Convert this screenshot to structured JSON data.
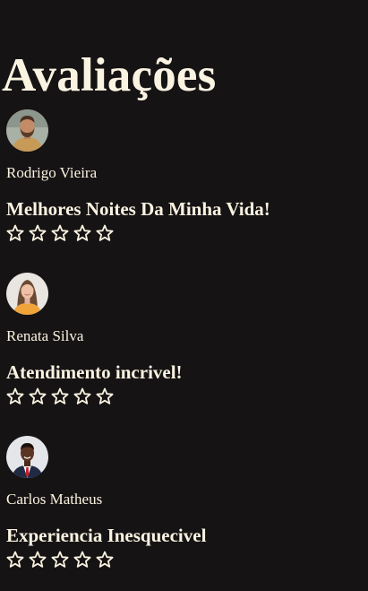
{
  "page": {
    "title": "Avaliações"
  },
  "reviews": [
    {
      "name": "Rodrigo Vieira",
      "title": "Melhores Noites Da Minha Vida!",
      "rating": 5,
      "avatar_icon": "man-beard-avatar"
    },
    {
      "name": "Renata Silva",
      "title": "Atendimento incrivel!",
      "rating": 5,
      "avatar_icon": "woman-avatar"
    },
    {
      "name": "Carlos Matheus",
      "title": "Experiencia Inesquecivel",
      "rating": 5,
      "avatar_icon": "man-suit-avatar"
    }
  ],
  "colors": {
    "background": "#151313",
    "text": "#fbf3e2"
  }
}
